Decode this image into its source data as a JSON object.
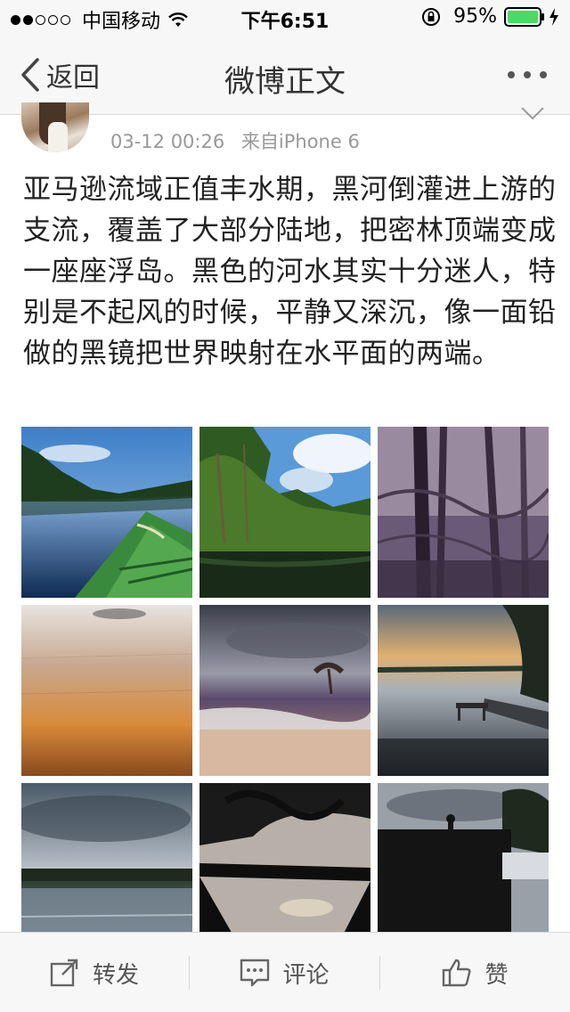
{
  "status_bar": {
    "carrier": "中国移动",
    "time": "下午6:51",
    "battery": "95%",
    "signal_bars_filled": 2,
    "signal_bars_total": 5
  },
  "nav": {
    "back_label": "返回",
    "title": "微博正文"
  },
  "post": {
    "timestamp": "03-12 00:26",
    "source": "来自iPhone 6",
    "text": "亚马逊流域正值丰水期，黑河倒灌进上游的支流，覆盖了大部分陆地，把密林顶端变成一座座浮岛。黑色的河水其实十分迷人，特别是不起风的时候，平静又深沉，像一面铅做的黑镜把世界映射在水平面的两端。"
  },
  "photos": [
    {
      "subject": "green boat bow on calm blue river"
    },
    {
      "subject": "flooded jungle trees under blue sky"
    },
    {
      "subject": "purple-toned flooded forest"
    },
    {
      "subject": "orange glowing water surface"
    },
    {
      "subject": "stormy clouds over shore waves"
    },
    {
      "subject": "sunset river with dock and boat"
    },
    {
      "subject": "cloudy sky over flat treeline"
    },
    {
      "subject": "dark silhouetted trees reflected in water"
    },
    {
      "subject": "hut silhouette at dusk"
    }
  ],
  "toolbar": {
    "repost_label": "转发",
    "comment_label": "评论",
    "like_label": "赞"
  }
}
